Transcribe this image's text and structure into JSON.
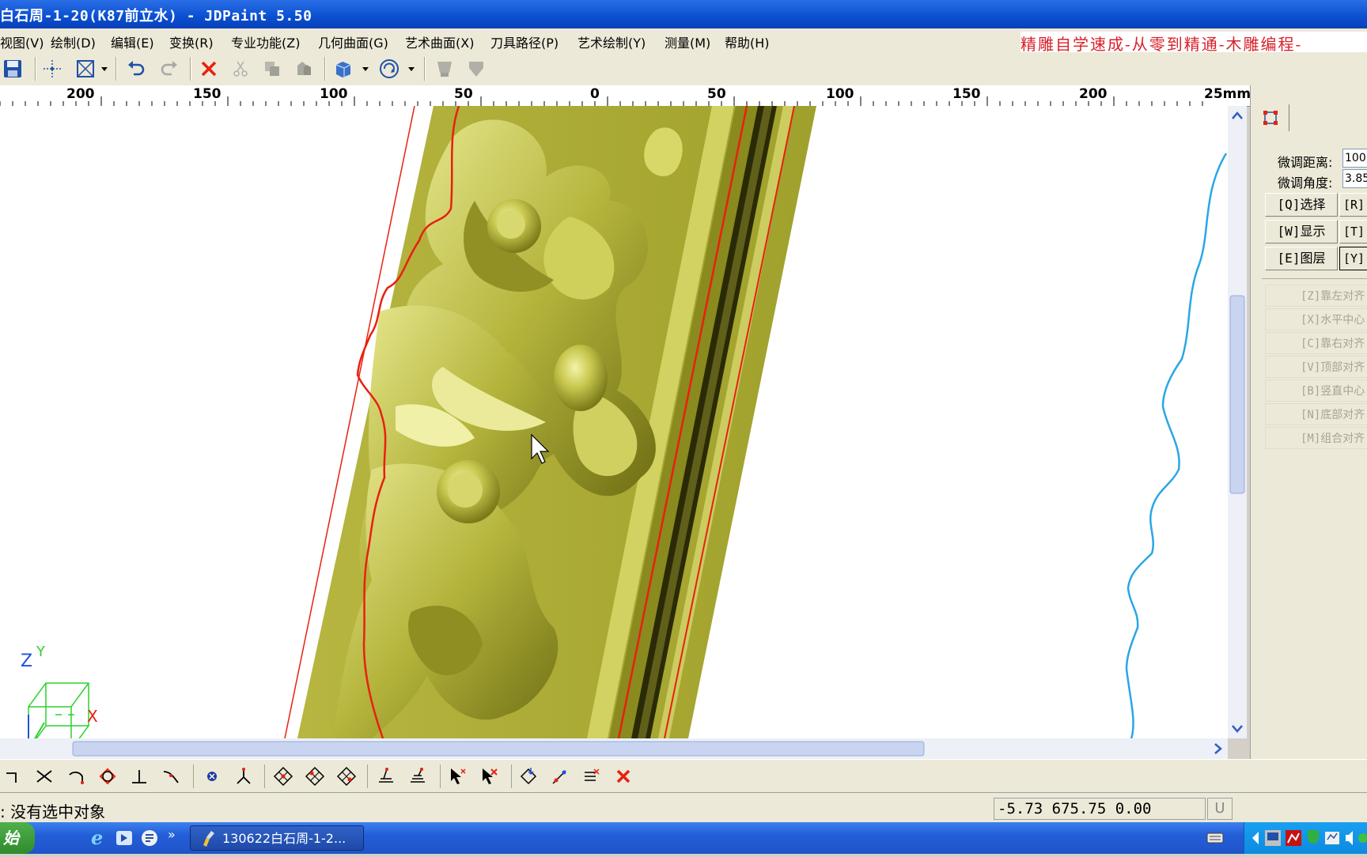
{
  "window": {
    "title": "白石周-1-20(K87前立水) - JDPaint 5.50"
  },
  "menu": [
    "视图(V)",
    "绘制(D)",
    "编辑(E)",
    "变换(R)",
    "专业功能(Z)",
    "几何曲面(G)",
    "艺术曲面(X)",
    "刀具路径(P)",
    "艺术绘制(Y)",
    "测量(M)",
    "帮助(H)"
  ],
  "banner": "精雕自学速成-从零到精通-木雕编程-",
  "ruler": {
    "labels": [
      "200",
      "150",
      "100",
      "50",
      "0",
      "50",
      "100",
      "150",
      "200",
      "25mm"
    ]
  },
  "right_panel": {
    "fine_distance_label": "微调距离:",
    "fine_distance_value": "100.",
    "fine_angle_label": "微调角度:",
    "fine_angle_value": "3.85",
    "buttons": [
      {
        "label": "[Q]选择",
        "side": "[R]"
      },
      {
        "label": "[W]显示",
        "side": "[T]"
      },
      {
        "label": "[E]图层",
        "side": "[Y]"
      }
    ],
    "align_buttons": [
      "[Z]靠左对齐",
      "[X]水平中心",
      "[C]靠右对齐",
      "[V]顶部对齐",
      "[B]竖直中心",
      "[N]底部对齐",
      "[M]组合对齐"
    ]
  },
  "axis_labels": {
    "z": "Z",
    "y": "Y",
    "x": "X"
  },
  "status": {
    "message": ": 没有选中对象",
    "coords": "-5.73 675.75 0.00",
    "unit_box": "U"
  },
  "taskbar": {
    "start_label": "始",
    "task_label": "130622白石周-1-2..."
  },
  "colors": {
    "model": "#a8a830",
    "model_highlight": "#e4e480",
    "toolpath_red": "#e82010",
    "profile_blue": "#2aa6e6",
    "title_blue": "#0a4fd0"
  }
}
